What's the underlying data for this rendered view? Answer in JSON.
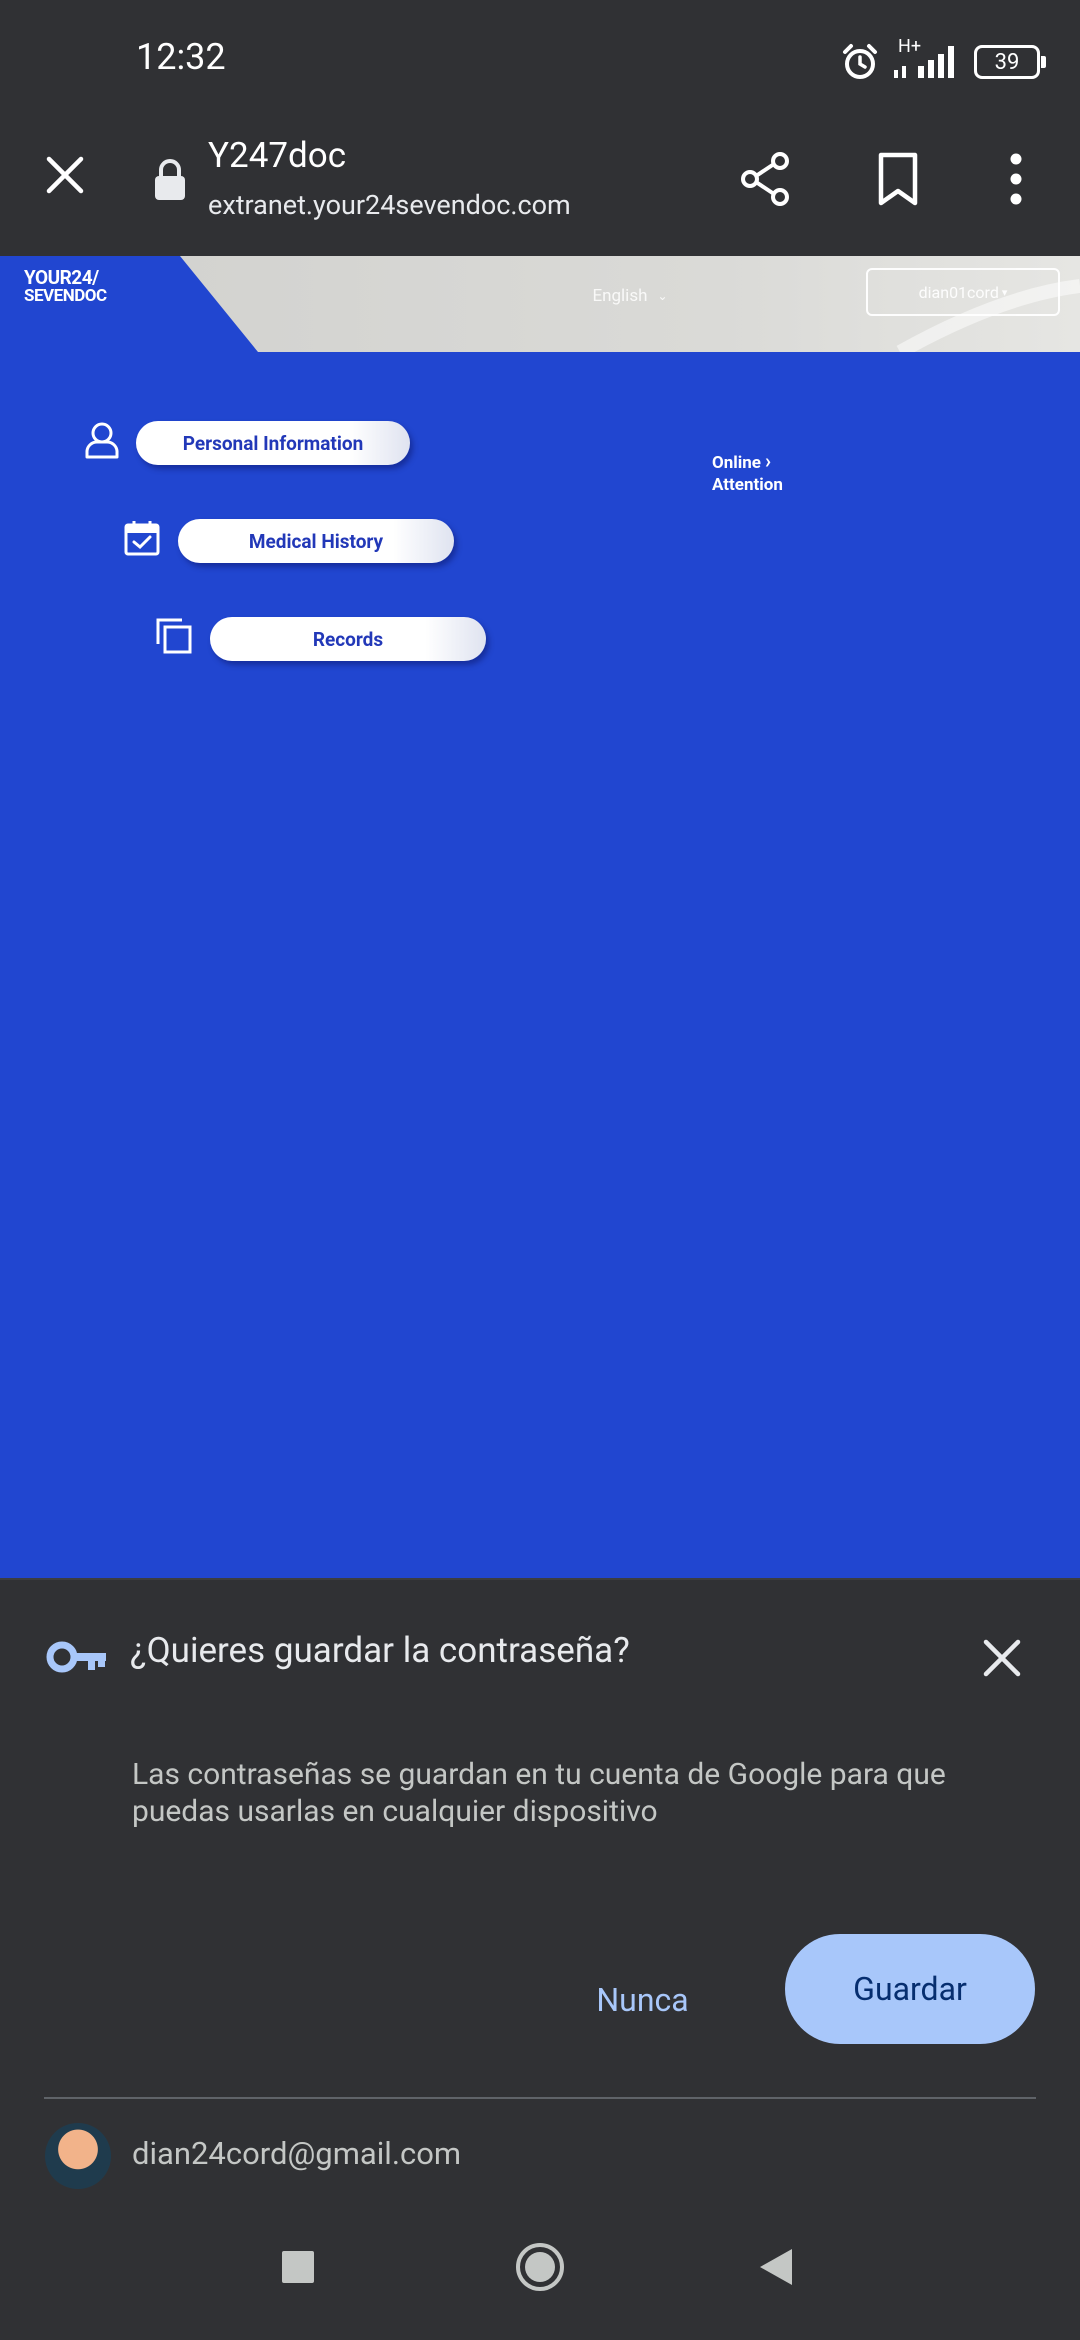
{
  "status_bar": {
    "time": "12:32",
    "network": "H+",
    "battery": "39"
  },
  "browser": {
    "page_title": "Y247doc",
    "url": "extranet.your24sevendoc.com",
    "close_icon": "close-icon",
    "lock_icon": "lock-icon",
    "share_icon": "share-icon",
    "bookmark_icon": "bookmark-icon",
    "menu_icon": "more-vert-icon"
  },
  "site": {
    "logo_line1": "YOUR24/",
    "logo_line2": "SEVENDOC",
    "language": "English",
    "user": "dian01cord",
    "menu": [
      {
        "label": "Personal Information",
        "icon": "user-icon"
      },
      {
        "label": "Medical History",
        "icon": "calendar-check-icon"
      },
      {
        "label": "Records",
        "icon": "copy-icon"
      }
    ],
    "online_line1": "Online",
    "online_line2": "Attention",
    "brand_color": "#2146d0"
  },
  "password_prompt": {
    "title": "¿Quieres guardar la contraseña?",
    "body": "Las contraseñas se guardan en tu cuenta de Google para que puedas usarlas en cualquier dispositivo",
    "never_label": "Nunca",
    "save_label": "Guardar",
    "email": "dian24cord@gmail.com"
  }
}
